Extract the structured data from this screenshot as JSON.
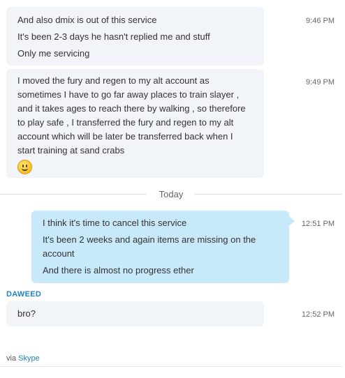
{
  "messages_incoming_1": {
    "lines": [
      "And also dmix is out of this service",
      "It's been 2-3 days he hasn't replied me and stuff",
      "Only me servicing"
    ],
    "time": "9:46 PM"
  },
  "messages_incoming_2": {
    "text": "I moved the fury and regen to my alt account as sometimes I have to go far away places to train slayer , and it takes ages to reach there by walking , so therefore to play safe , I transferred the fury and regen to my alt account which will be later be transferred back when I start training at sand crabs",
    "emoji": "smile-emoji",
    "time": "9:49 PM"
  },
  "divider": {
    "label": "Today"
  },
  "messages_outgoing": {
    "lines": [
      "I think it's time to cancel this service",
      "It's been 2 weeks and again items are missing on the account",
      "And there is almost no progress ether"
    ],
    "time": "12:51 PM"
  },
  "sender": {
    "name": "DAWEED"
  },
  "messages_incoming_3": {
    "text": "bro?",
    "time": "12:52 PM"
  },
  "footer": {
    "prefix": "via ",
    "link": "Skype"
  },
  "colors": {
    "incoming_bubble": "#f1f4f8",
    "outgoing_bubble": "#c7e9f9",
    "link": "#1f84c4"
  }
}
